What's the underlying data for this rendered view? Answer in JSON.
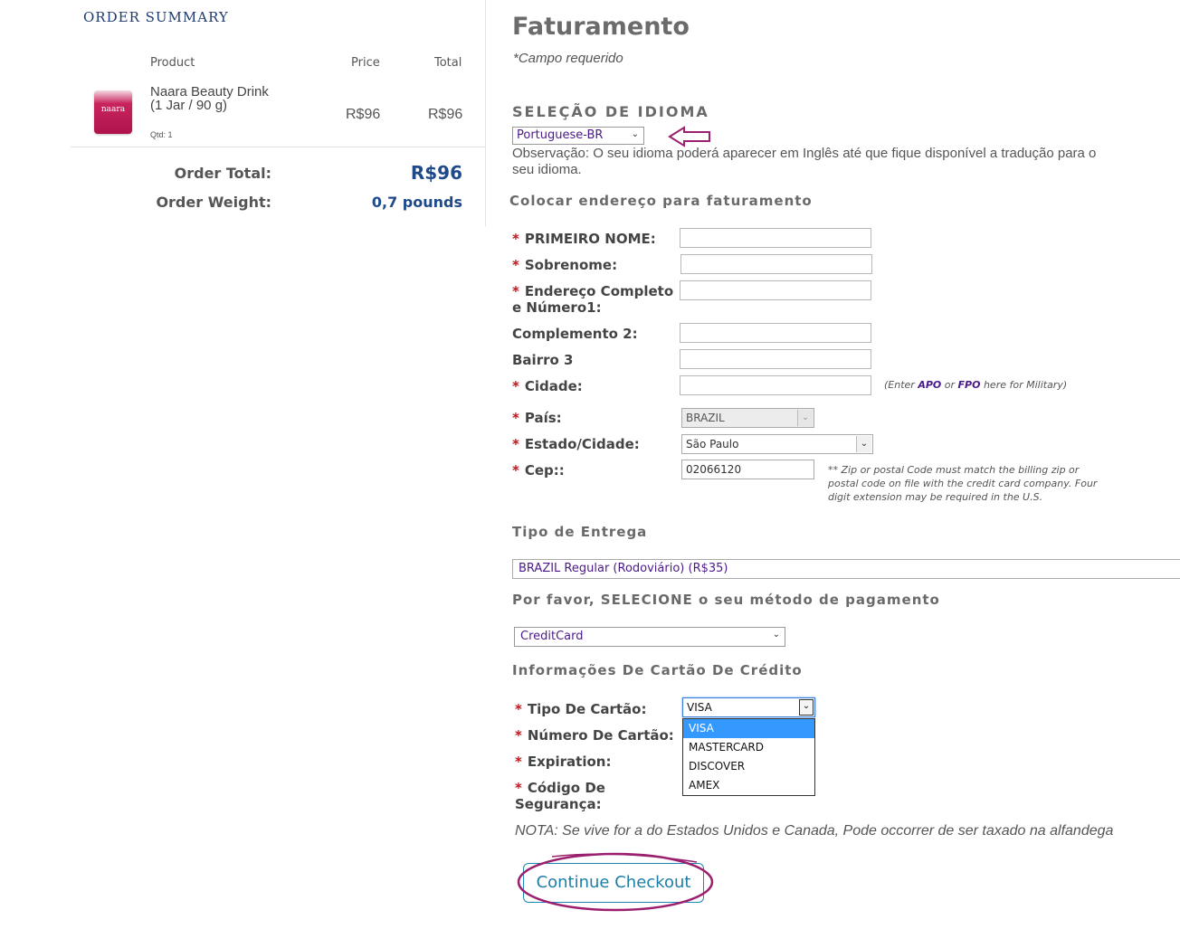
{
  "summary": {
    "title": "ORDER SUMMARY",
    "headers": {
      "product": "Product",
      "price": "Price",
      "total": "Total"
    },
    "item": {
      "image_text": "naara",
      "name_line1": "Naara Beauty Drink",
      "name_line2": "(1 Jar / 90 g)",
      "qty": "Qtd: 1",
      "price": "R$96",
      "total": "R$96"
    },
    "order_total_label": "Order Total:",
    "order_total_value": "R$96",
    "order_weight_label": "Order Weight:",
    "order_weight_value": "0,7 pounds"
  },
  "form": {
    "title": "Faturamento",
    "required_note": "*Campo requerido",
    "language_heading": "SELEÇÃO DE IDIOMA",
    "language_value": "Portuguese-BR",
    "observation": "Observação: O seu idioma poderá aparecer em Inglês até que fique disponível a tradução para o seu idioma.",
    "billing_heading": "Colocar endereço para faturamento",
    "star": "*",
    "first_name": "PRIMEIRO NOME:",
    "last_name": "Sobrenome:",
    "address1_line1": "Endereço Completo",
    "address1_line2": "e Número1:",
    "address2": "Complemento 2:",
    "address3": "Bairro 3",
    "city": "Cidade:",
    "city_hint_pre": "(Enter ",
    "city_hint_apo": "APO",
    "city_hint_mid": " or ",
    "city_hint_fpo": "FPO",
    "city_hint_post": " here for Military)",
    "country_label": "País:",
    "country_value": "BRAZIL",
    "state_label": "Estado/Cidade:",
    "state_value": "São Paulo",
    "zip_label": "Cep::",
    "zip_value": "02066120",
    "zip_hint": "** Zip or postal Code must match the billing zip or postal code on file with the credit card company. Four digit extension may be required in the U.S.",
    "shipping_heading": "Tipo de Entrega",
    "shipping_value": "BRAZIL Regular (Rodoviário) (R$35)",
    "payment_heading": "Por favor, SELECIONE o seu método de pagamento",
    "payment_value": "CreditCard",
    "card_heading": "Informações De Cartão De Crédito",
    "card_type_label": "Tipo De Cartão:",
    "card_type_value": "VISA",
    "card_options": [
      "VISA",
      "MASTERCARD",
      "DISCOVER",
      "AMEX"
    ],
    "card_number_label": "Número De Cartão:",
    "expiration_label": "Expiration:",
    "cvv_line1": "Código De",
    "cvv_line2": "Segurança:",
    "nota": "NOTA: Se vive for a do Estados Unidos e Canada, Pode occorrer de ser taxado na alfandega",
    "checkout_button": "Continue Checkout"
  },
  "annotation_color": "#9b1f6e"
}
